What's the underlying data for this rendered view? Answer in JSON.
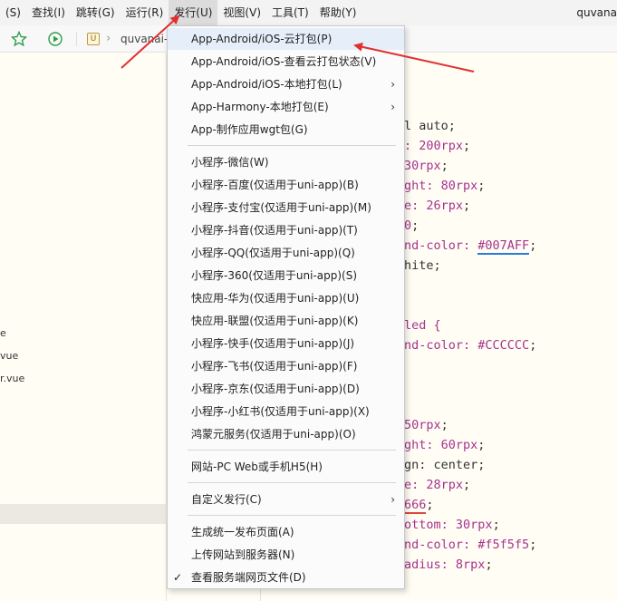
{
  "menubar": {
    "items": [
      "(S)",
      "查找(I)",
      "跳转(G)",
      "运行(R)",
      "发行(U)",
      "视图(V)",
      "工具(T)",
      "帮助(Y)"
    ],
    "title": "quvana"
  },
  "toolbar": {
    "breadcrumb_file_icon": "U",
    "breadcrumb_sep": "›",
    "breadcrumb_text": "quvanai-"
  },
  "sidebar": {
    "items": [
      "e",
      "vue",
      "r.vue"
    ]
  },
  "dropdown": {
    "items": [
      "App-Android/iOS-云打包(P)",
      "App-Android/iOS-查看云打包状态(V)",
      "App-Android/iOS-本地打包(L)",
      "App-Harmony-本地打包(E)",
      "App-制作应用wgt包(G)",
      "小程序-微信(W)",
      "小程序-百度(仅适用于uni-app)(B)",
      "小程序-支付宝(仅适用于uni-app)(M)",
      "小程序-抖音(仅适用于uni-app)(T)",
      "小程序-QQ(仅适用于uni-app)(Q)",
      "小程序-360(仅适用于uni-app)(S)",
      "快应用-华为(仅适用于uni-app)(U)",
      "快应用-联盟(仅适用于uni-app)(K)",
      "小程序-快手(仅适用于uni-app)(J)",
      "小程序-飞书(仅适用于uni-app)(F)",
      "小程序-京东(仅适用于uni-app)(D)",
      "小程序-小红书(仅适用于uni-app)(X)",
      "鸿蒙元服务(仅适用于uni-app)(O)",
      "网站-PC Web或手机H5(H)",
      "自定义发行(C)",
      "生成统一发布页面(A)",
      "上传网站到服务器(N)",
      "查看服务端网页文件(D)"
    ],
    "submenu_arrow": "›",
    "check_mark": "✓"
  },
  "code": {
    "lines": [
      [
        "l auto;"
      ],
      [
        ": ",
        "200",
        "rpx",
        ";"
      ],
      [
        "30",
        "rpx",
        ";"
      ],
      [
        "ght: ",
        "80",
        "rpx",
        ";"
      ],
      [
        "e: ",
        "26",
        "rpx",
        ";"
      ],
      [
        "0",
        ";"
      ],
      [
        "nd-color: ",
        "#007AFF",
        ";"
      ],
      [
        "hite;"
      ],
      [
        "led {"
      ],
      [
        "nd-color: ",
        "#CCCCCC",
        ";"
      ],
      [
        "50",
        "rpx",
        ";"
      ],
      [
        "ght: ",
        "60",
        "rpx",
        ";"
      ],
      [
        "gn: center;"
      ],
      [
        "e: ",
        "28",
        "rpx",
        ";"
      ],
      [
        "666",
        ";"
      ],
      [
        "ottom: ",
        "30",
        "rpx",
        ";"
      ],
      [
        "nd-color: ",
        "#f5f5f5",
        ";"
      ],
      [
        "adius: ",
        "8",
        "rpx",
        ";"
      ]
    ]
  },
  "colors": {
    "menu_highlight": "#e6eef9",
    "annotation_red": "#e03030",
    "link_blue": "#2a7bd4"
  }
}
